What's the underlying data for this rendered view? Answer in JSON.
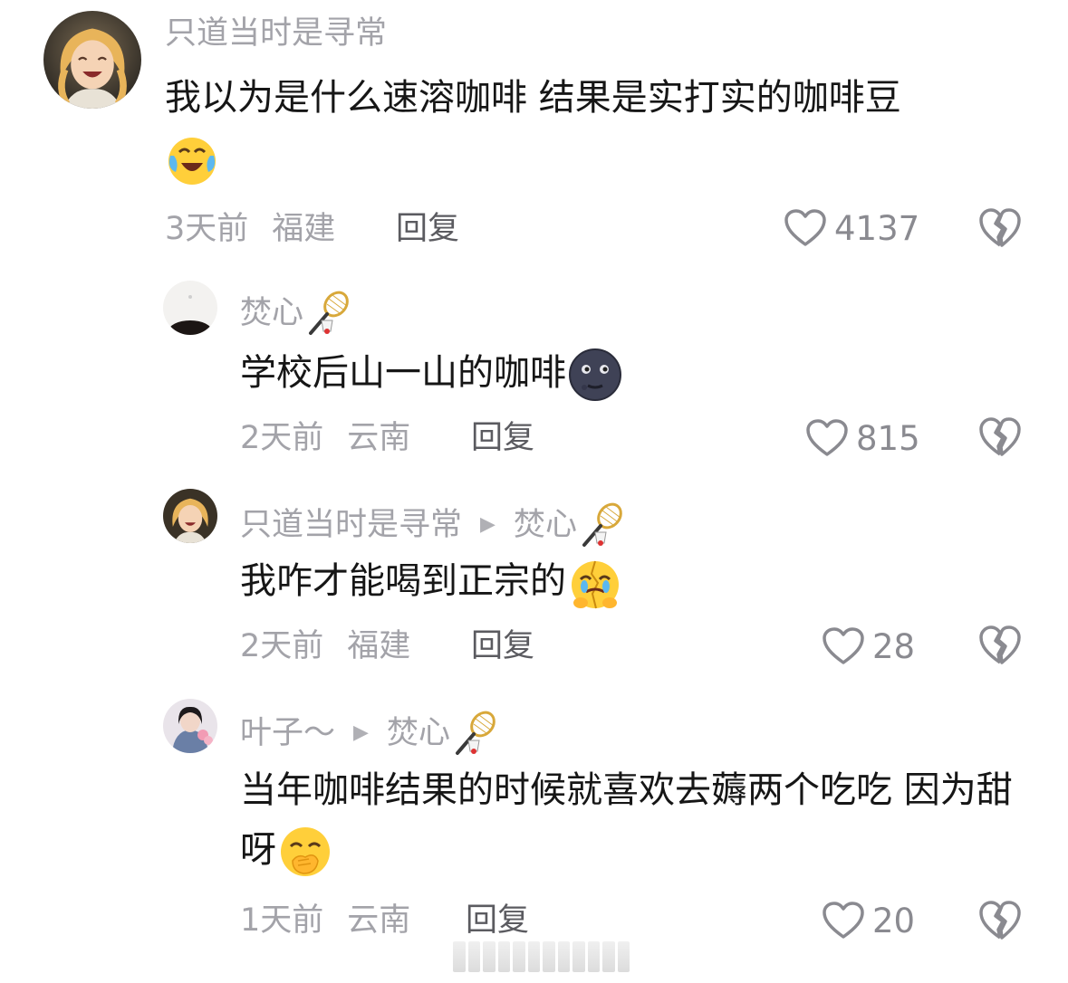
{
  "comments": [
    {
      "username": "只道当时是寻常",
      "text": "我以为是什么速溶咖啡 结果是实打实的咖啡豆",
      "emoji": "crying-laughing-emoji",
      "time": "3天前",
      "location": "福建",
      "reply_label": "回复",
      "likes": "4137"
    },
    {
      "username": "焚心",
      "text": "学校后山一山的咖啡",
      "emoji": "new-moon-face-emoji",
      "time": "2天前",
      "location": "云南",
      "reply_label": "回复",
      "likes": "815"
    },
    {
      "username": "只道当时是寻常",
      "reply_to": "焚心",
      "text": "我咋才能喝到正宗的",
      "emoji": "broken-crying-emoji",
      "time": "2天前",
      "location": "福建",
      "reply_label": "回复",
      "likes": "28"
    },
    {
      "username": "叶子～",
      "reply_to": "焚心",
      "text": "当年咖啡结果的时候就喜欢去薅两个吃吃 因为甜呀",
      "emoji": "hand-over-mouth-emoji",
      "time": "1天前",
      "location": "云南",
      "reply_label": "回复",
      "likes": "20"
    }
  ],
  "colors": {
    "meta_gray": "#a3a3a9",
    "text": "#161616",
    "icon_gray": "#8a8a90"
  }
}
